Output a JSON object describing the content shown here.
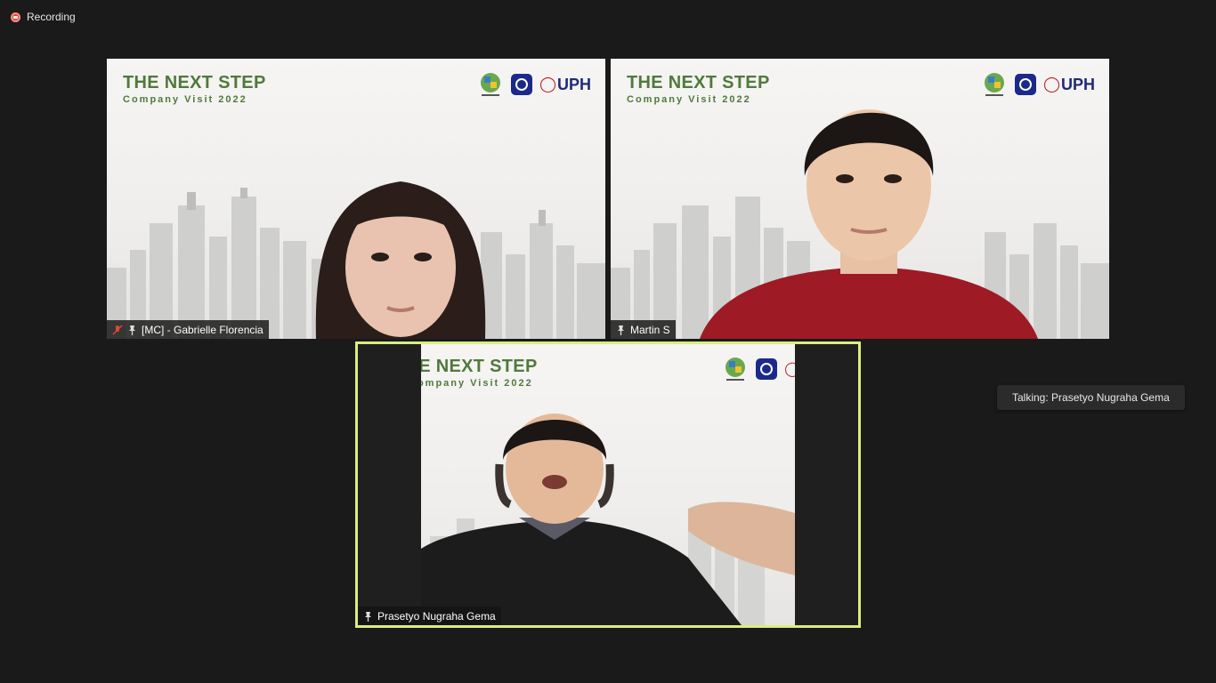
{
  "recording": {
    "label": "Recording"
  },
  "banner": {
    "title": "THE NEXT STEP",
    "subtitle": "Company Visit 2022",
    "logo_text": "UPH"
  },
  "participants": [
    {
      "name": "[MC] - Gabrielle Florencia",
      "muted": true
    },
    {
      "name": "Martin S",
      "muted": false
    },
    {
      "name": "Prasetyo Nugraha Gema",
      "muted": false,
      "active_speaker": true
    }
  ],
  "talking": {
    "label": "Talking: Prasetyo Nugraha Gema"
  },
  "colors": {
    "background": "#1a1a1a",
    "active_speaker_border": "#d8ef7e",
    "banner_green": "#4f7a3c",
    "muted_icon": "#e0453a",
    "recording_dot": "#e0453a"
  },
  "icons": [
    "recording-icon",
    "mic-muted-icon",
    "pin-icon",
    "logo-icon"
  ]
}
